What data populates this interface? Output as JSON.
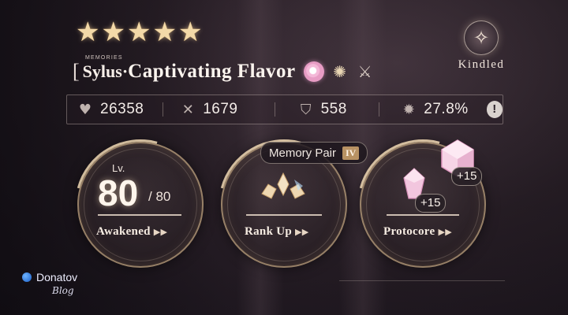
{
  "header": {
    "stars": [
      "★",
      "★",
      "★",
      "★",
      "★"
    ],
    "memories_tag": "MEMORIES",
    "bracket": "[",
    "character": "Sylus·",
    "title": "Captivating Flavor",
    "kindled_label": "Kindled"
  },
  "stats": [
    {
      "icon": "heart-icon",
      "glyph": "♥",
      "value": "26358"
    },
    {
      "icon": "swords-icon",
      "glyph": "✕",
      "value": "1679"
    },
    {
      "icon": "shield-icon",
      "glyph": "⛉",
      "value": "558"
    },
    {
      "icon": "crit-burst-icon",
      "glyph": "✹",
      "value": "27.8%"
    }
  ],
  "info_glyph": "!",
  "level": {
    "label": "Lv.",
    "value": "80",
    "max": "/ 80",
    "button": "Awakened",
    "arrows": "▶▶"
  },
  "rank": {
    "pair_label": "Memory Pair",
    "pair_badge": "IV",
    "button": "Rank Up",
    "arrows": "▶▶"
  },
  "protocore": {
    "button": "Protocore",
    "arrows": "▶▶",
    "plus_a": "+15",
    "plus_b": "+15"
  },
  "watermark": {
    "brand": "Donatov",
    "sub": "Blog"
  },
  "colors": {
    "accent_gold": "#e1c396",
    "pink_gem": "#f4b8d8"
  }
}
